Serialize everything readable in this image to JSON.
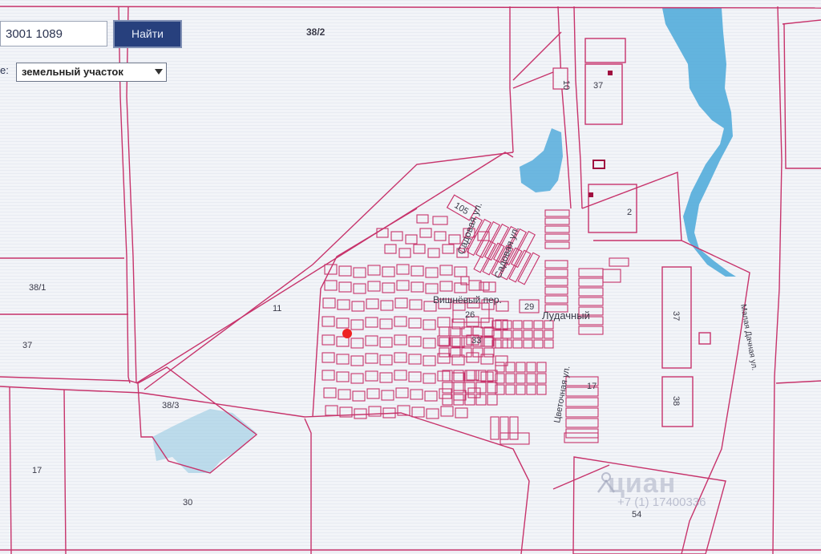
{
  "search": {
    "value": "3001 1089",
    "button_label": "Найти"
  },
  "type_filter": {
    "label": "е:",
    "selected": "земельный участок"
  },
  "map": {
    "labels": {
      "top_parcel": "38/2",
      "left_parcel_1": "38/1",
      "left_parcel_2": "37",
      "center_area": "11",
      "bottom_left_parcel": "38/3",
      "far_left_parcel": "17",
      "bottom_parcel": "30",
      "top_right_block": "37",
      "right_block": "2",
      "road_code_1": "10",
      "road_code_2": "105",
      "block_26": "26",
      "block_29": "29",
      "block_33": "33",
      "block_17": "17",
      "right_rect_1": "37",
      "right_rect_2": "38",
      "bottom_right": "54",
      "street_1": "Садовая ул.",
      "street_2": "Садовая ул.",
      "street_3": "Вишнёвый пер.",
      "street_4": "Лудачный",
      "street_5": "Цветочная ул.",
      "street_6": "Малая Дачная ул."
    },
    "colors": {
      "parcel_line": "#c7336b",
      "water": "#4aa8d9",
      "marker": "#ee2222",
      "background": "#f2f4f8"
    }
  },
  "watermark": {
    "brand": "циан",
    "phone": "+7 (1) 17400336"
  }
}
